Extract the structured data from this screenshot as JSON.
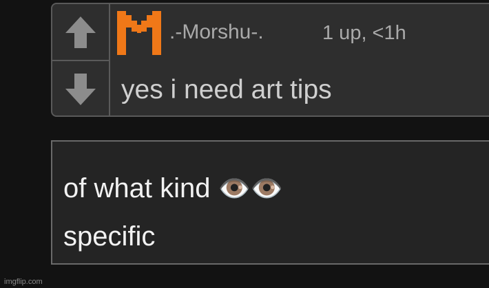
{
  "comment": {
    "username": ".-Morshu-.",
    "meta": "1 up, <1h",
    "text": "yes i need art tips",
    "avatar_icon": "orange-pixel-m-avatar"
  },
  "votes": {
    "upvote_icon": "arrow-up-icon",
    "downvote_icon": "arrow-down-icon"
  },
  "reply": {
    "line1": "of what kind",
    "line1_emoji": "👁️👁️",
    "line2": "specific"
  },
  "watermark": "imgflip.com",
  "colors": {
    "accent_orange": "#f07818",
    "background": "#121212",
    "comment_bg": "#2e2e2e",
    "reply_bg": "#242424"
  }
}
